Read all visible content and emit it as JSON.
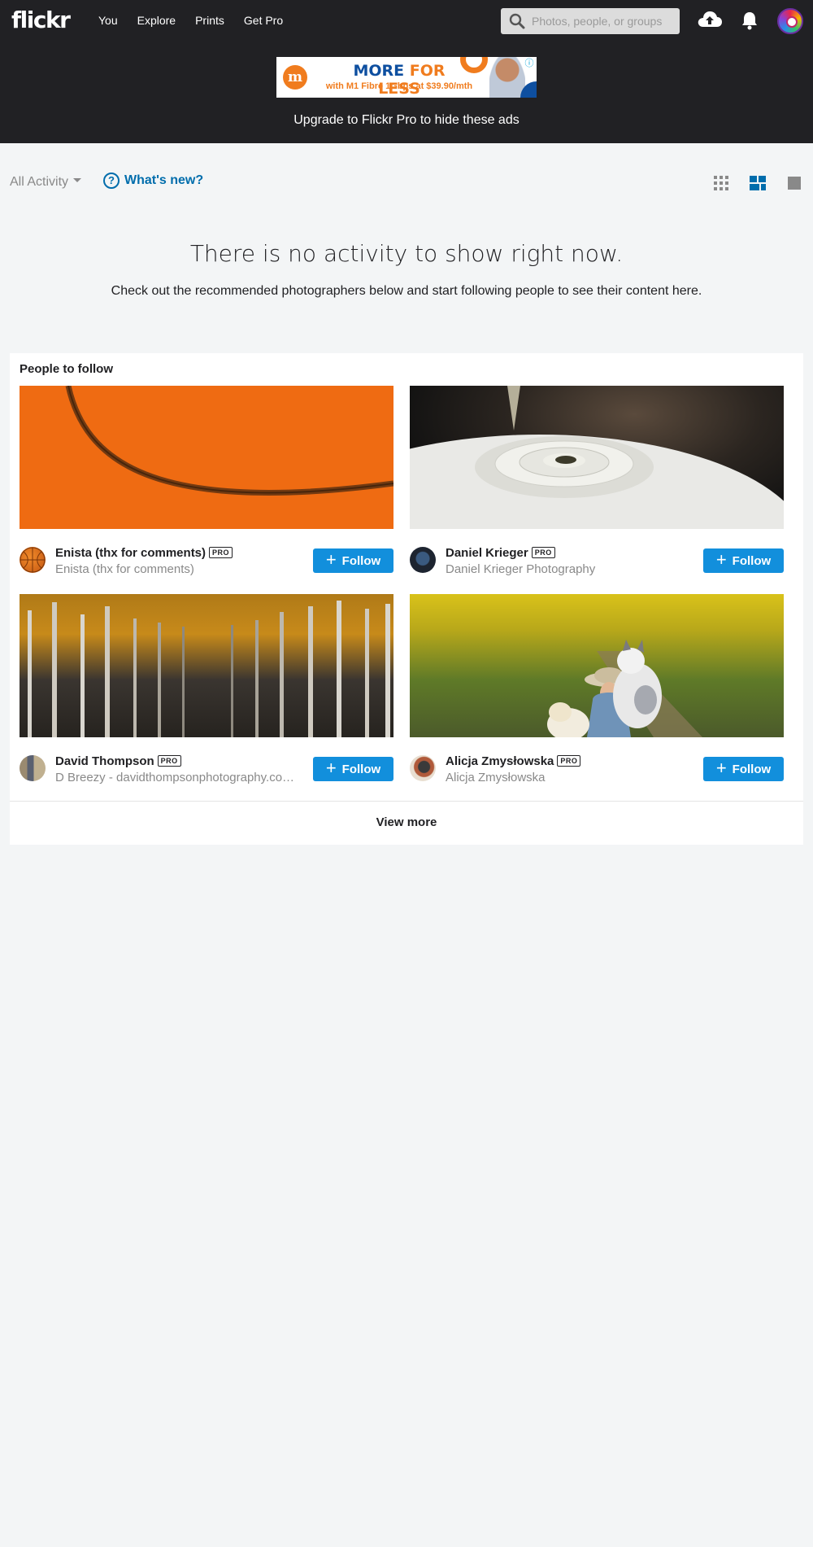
{
  "header": {
    "logo": "flickr",
    "nav": [
      "You",
      "Explore",
      "Prints",
      "Get Pro"
    ],
    "search_placeholder": "Photos, people, or groups",
    "icons": [
      "search-icon",
      "upload-cloud-icon",
      "bell-icon",
      "avatar"
    ]
  },
  "ad": {
    "logo_text": "m",
    "headline_blue": "MORE",
    "headline_orange": "FOR LESS",
    "sub": "with M1 Fibre 1Gbps at $39.90/mth",
    "info": "ⓘ",
    "close": "✕",
    "upgrade_text": "Upgrade to Flickr Pro to hide these ads"
  },
  "toolbar": {
    "filter_label": "All Activity",
    "whats_new_label": "What's new?",
    "view_modes": [
      "grid-view-icon",
      "tile-view-icon",
      "single-view-icon"
    ]
  },
  "empty_state": {
    "title": "There is no activity to show right now.",
    "subtitle": "Check out the recommended photographers below and start following people to see their content here."
  },
  "people": {
    "title": "People to follow",
    "badge": "PRO",
    "follow_label": "Follow",
    "view_more_label": "View more",
    "items": [
      {
        "name": "Enista (thx for comments)",
        "subtitle": "Enista (thx for comments)",
        "pro": true
      },
      {
        "name": "Daniel Krieger",
        "subtitle": "Daniel Krieger Photography",
        "pro": true
      },
      {
        "name": "David Thompson",
        "subtitle": "D Breezy - davidthompsonphotography.co…",
        "pro": true
      },
      {
        "name": "Alicja Zmysłowska",
        "subtitle": "Alicja Zmysłowska",
        "pro": true
      }
    ]
  },
  "colors": {
    "header_bg": "#212124",
    "page_bg": "#f3f5f6",
    "follow_blue": "#128fdc",
    "link_blue": "#006dac"
  }
}
